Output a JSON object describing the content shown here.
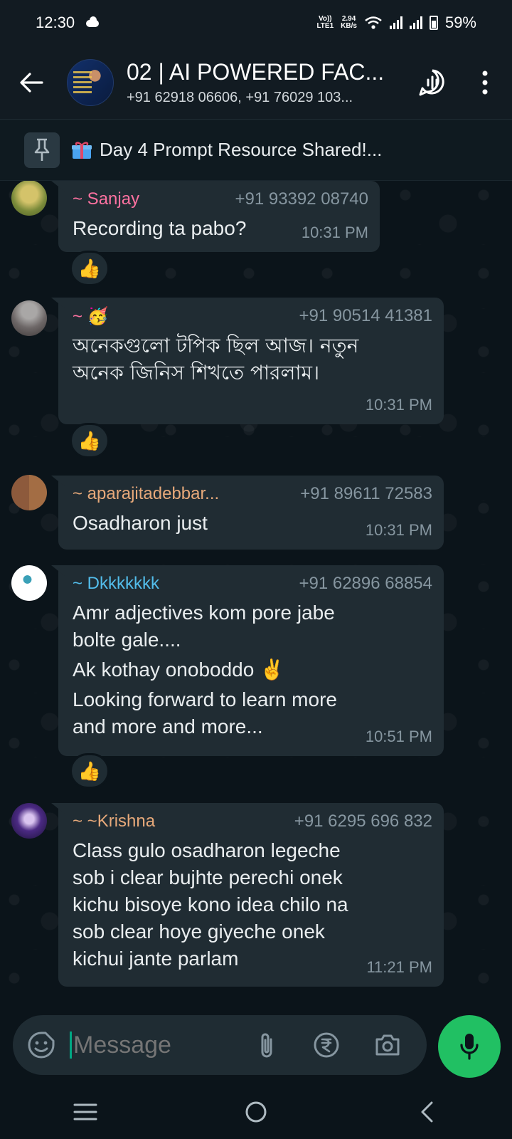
{
  "status_bar": {
    "time": "12:30",
    "network_type": "LTE1",
    "volte": "Vo))",
    "speed_value": "2.94",
    "speed_unit": "KB/s",
    "battery": "59%"
  },
  "header": {
    "title": "02 | AI POWERED FAC...",
    "subtitle": "+91 62918 06606, +91 76029 103..."
  },
  "pinned": {
    "text": "Day 4 Prompt Resource Shared!..."
  },
  "messages": [
    {
      "sender": "~ Sanjay",
      "sender_color": "#ff72a1",
      "phone": "+91 93392 08740",
      "lines": [
        "Recording ta pabo?"
      ],
      "time": "10:31 PM",
      "reaction": "👍"
    },
    {
      "sender": "~ 🥳",
      "sender_color": "#ff72a1",
      "phone": "+91 90514 41381",
      "lines": [
        "অনেকগুলো টপিক ছিল আজ। নতুন",
        "অনেক জিনিস শিখতে পারলাম।"
      ],
      "time": "10:31 PM",
      "reaction": "👍"
    },
    {
      "sender": "~ aparajitadebbar...",
      "sender_color": "#e7a97a",
      "phone": "+91 89611 72583",
      "lines": [
        "Osadharon just"
      ],
      "time": "10:31 PM"
    },
    {
      "sender": "~ Dkkkkkkk",
      "sender_color": "#53bdeb",
      "phone": "+91 62896 68854",
      "lines": [
        "Amr adjectives kom pore jabe",
        "bolte gale....",
        "Ak kothay onoboddo ✌️",
        "Looking forward to learn more",
        "and more and more..."
      ],
      "time": "10:51 PM",
      "reaction": "👍"
    },
    {
      "sender": "~ ~Krishna",
      "sender_color": "#e7a97a",
      "phone": "+91 6295 696 832",
      "lines": [
        "Class gulo osadharon legeche",
        "sob i clear bujhte perechi onek",
        "kichu bisoye kono idea chilo na",
        "sob clear hoye giyeche onek",
        "kichui jante parlam"
      ],
      "time": "11:21 PM"
    }
  ],
  "input": {
    "placeholder": "Message"
  },
  "colors": {
    "accent_green": "#21c063",
    "bubble": "#202c33",
    "background": "#0b141a"
  }
}
